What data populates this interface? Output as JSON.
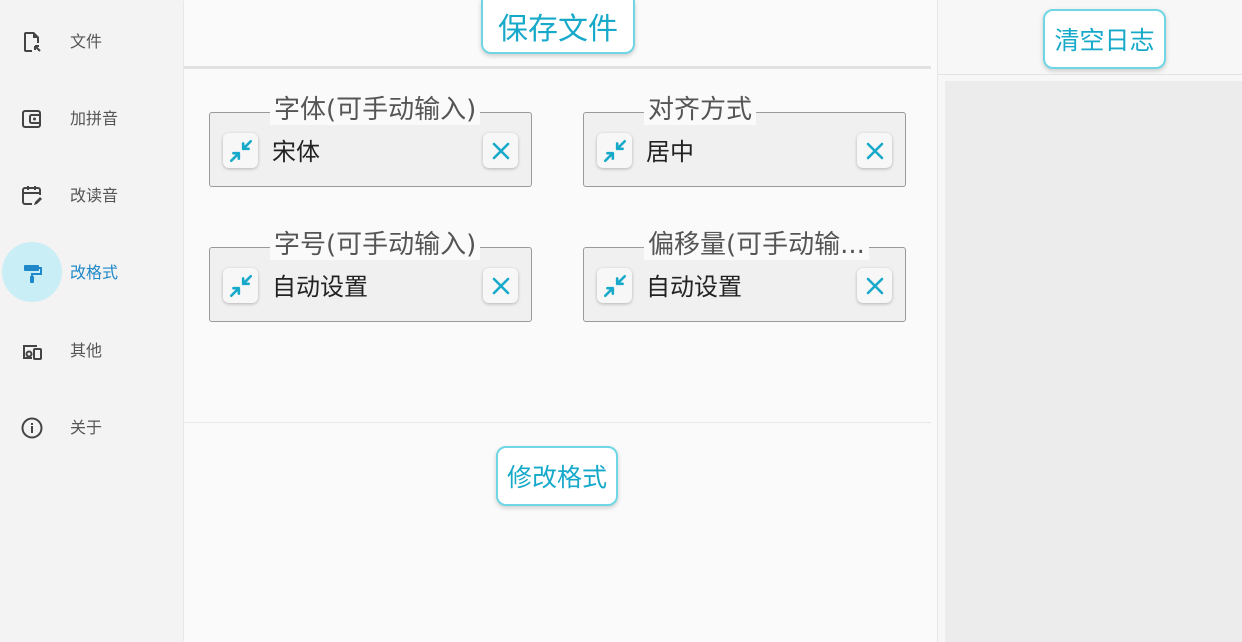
{
  "sidebar": {
    "items": [
      {
        "label": "文件",
        "icon": "file-icon"
      },
      {
        "label": "加拼音",
        "icon": "wallet-icon"
      },
      {
        "label": "改读音",
        "icon": "calendar-edit-icon"
      },
      {
        "label": "改格式",
        "icon": "format-paint-icon",
        "active": true
      },
      {
        "label": "其他",
        "icon": "devices-icon"
      },
      {
        "label": "关于",
        "icon": "info-icon"
      }
    ]
  },
  "main": {
    "save_label": "保存文件",
    "apply_label": "修改格式",
    "fields": {
      "font": {
        "legend": "字体(可手动输入)",
        "value": "宋体"
      },
      "align": {
        "legend": "对齐方式",
        "value": "居中"
      },
      "size": {
        "legend": "字号(可手动输入)",
        "value": "自动设置"
      },
      "offset": {
        "legend": "偏移量(可手动输...",
        "value": "自动设置"
      }
    }
  },
  "log": {
    "clear_label": "清空日志"
  },
  "colors": {
    "accent": "#17a9c9",
    "active_nav_bg": "#c9eef6",
    "active_nav_text": "#1e88c8"
  }
}
